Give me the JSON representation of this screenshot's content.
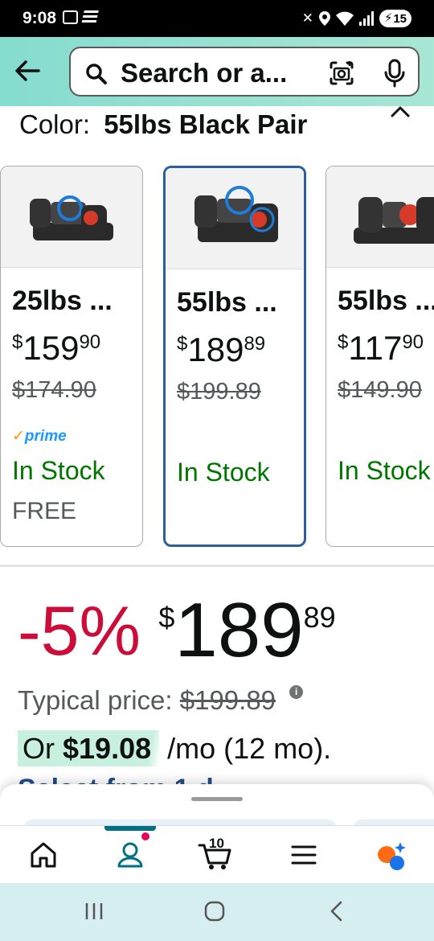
{
  "status_bar": {
    "time": "9:08",
    "battery": "15"
  },
  "search": {
    "placeholder": "Search or a..."
  },
  "color": {
    "label": "Color:",
    "value": "55lbs Black Pair"
  },
  "variants": [
    {
      "title": "25lbs ...",
      "currency": "$",
      "price_whole": "159",
      "price_fraction": "90",
      "list_price": "$174.90",
      "prime": "prime",
      "stock": "In Stock",
      "shipping": "FREE",
      "selected": false
    },
    {
      "title": "55lbs ...",
      "currency": "$",
      "price_whole": "189",
      "price_fraction": "89",
      "list_price": "$199.89",
      "prime": "",
      "stock": "In Stock",
      "shipping": "",
      "selected": true
    },
    {
      "title": "55lbs ...",
      "currency": "$",
      "price_whole": "117",
      "price_fraction": "90",
      "list_price": "$149.90",
      "prime": "",
      "stock": "In Stock",
      "shipping": "",
      "selected": false
    }
  ],
  "price": {
    "discount": "-5%",
    "currency": "$",
    "whole": "189",
    "fraction": "89",
    "typical_label": "Typical price:",
    "typical_value": "$199.89"
  },
  "monthly": {
    "prefix": "Or",
    "amount": "$19.08",
    "suffix": "/mo (12 mo)."
  },
  "peek_text": "Select from 1 d",
  "nav": {
    "cart_count": "10"
  },
  "colors": {
    "header_gradient_start": "#85dccf",
    "discount_red": "#cc0c39",
    "stock_green": "#007600",
    "selected_border": "#2f5f9a",
    "nav_accent": "#007185"
  }
}
